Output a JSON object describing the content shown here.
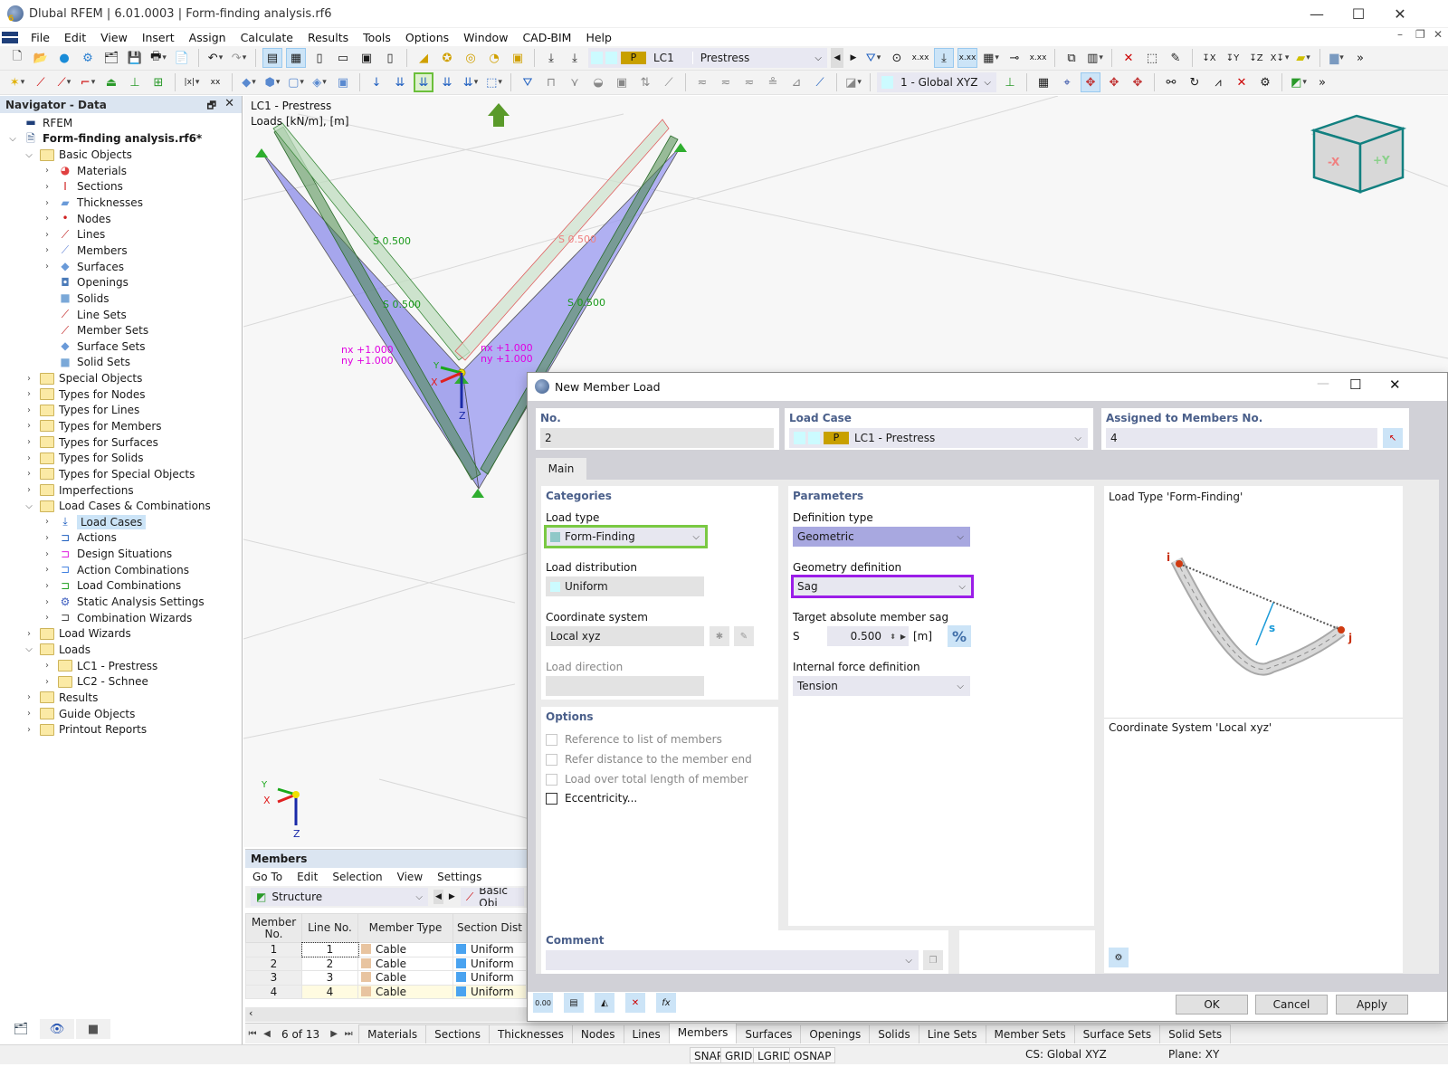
{
  "app": {
    "title": "Dlubal RFEM | 6.01.0003 | Form-finding analysis.rf6",
    "window_controls": {
      "minimize": "—",
      "maximize": "☐",
      "close": "✕"
    }
  },
  "menu": [
    "File",
    "Edit",
    "View",
    "Insert",
    "Assign",
    "Calculate",
    "Results",
    "Tools",
    "Options",
    "Window",
    "CAD-BIM",
    "Help"
  ],
  "toolbar": {
    "load_case": {
      "badge": "P",
      "code": "LC1",
      "name": "Prestress"
    },
    "coordinate_system": "1 - Global XYZ",
    "highlighted_tool": "member-load-button"
  },
  "navigator": {
    "title": "Navigator - Data",
    "items": [
      {
        "label": "RFEM",
        "level": 0,
        "icon": "rfem-icon",
        "chevron": ""
      },
      {
        "label": "Form-finding analysis.rf6*",
        "level": 0,
        "icon": "model-file-icon",
        "chevron": "open",
        "bold": true
      },
      {
        "label": "Basic Objects",
        "level": 1,
        "icon": "folder-icon",
        "chevron": "open"
      },
      {
        "label": "Materials",
        "level": 2,
        "icon": "materials-icon",
        "chevron": "closed"
      },
      {
        "label": "Sections",
        "level": 2,
        "icon": "sections-icon",
        "chevron": "closed"
      },
      {
        "label": "Thicknesses",
        "level": 2,
        "icon": "thicknesses-icon",
        "chevron": "closed"
      },
      {
        "label": "Nodes",
        "level": 2,
        "icon": "nodes-icon",
        "chevron": "closed"
      },
      {
        "label": "Lines",
        "level": 2,
        "icon": "lines-icon",
        "chevron": "closed"
      },
      {
        "label": "Members",
        "level": 2,
        "icon": "members-icon",
        "chevron": "closed"
      },
      {
        "label": "Surfaces",
        "level": 2,
        "icon": "surfaces-icon",
        "chevron": "closed"
      },
      {
        "label": "Openings",
        "level": 2,
        "icon": "openings-icon",
        "chevron": ""
      },
      {
        "label": "Solids",
        "level": 2,
        "icon": "solids-icon",
        "chevron": ""
      },
      {
        "label": "Line Sets",
        "level": 2,
        "icon": "line-sets-icon",
        "chevron": ""
      },
      {
        "label": "Member Sets",
        "level": 2,
        "icon": "member-sets-icon",
        "chevron": ""
      },
      {
        "label": "Surface Sets",
        "level": 2,
        "icon": "surface-sets-icon",
        "chevron": ""
      },
      {
        "label": "Solid Sets",
        "level": 2,
        "icon": "solid-sets-icon",
        "chevron": ""
      },
      {
        "label": "Special Objects",
        "level": 1,
        "icon": "folder-icon",
        "chevron": "closed"
      },
      {
        "label": "Types for Nodes",
        "level": 1,
        "icon": "folder-icon",
        "chevron": "closed"
      },
      {
        "label": "Types for Lines",
        "level": 1,
        "icon": "folder-icon",
        "chevron": "closed"
      },
      {
        "label": "Types for Members",
        "level": 1,
        "icon": "folder-icon",
        "chevron": "closed"
      },
      {
        "label": "Types for Surfaces",
        "level": 1,
        "icon": "folder-icon",
        "chevron": "closed"
      },
      {
        "label": "Types for Solids",
        "level": 1,
        "icon": "folder-icon",
        "chevron": "closed"
      },
      {
        "label": "Types for Special Objects",
        "level": 1,
        "icon": "folder-icon",
        "chevron": "closed"
      },
      {
        "label": "Imperfections",
        "level": 1,
        "icon": "folder-icon",
        "chevron": "closed"
      },
      {
        "label": "Load Cases & Combinations",
        "level": 1,
        "icon": "folder-icon",
        "chevron": "open"
      },
      {
        "label": "Load Cases",
        "level": 2,
        "icon": "load-cases-icon",
        "chevron": "closed",
        "selected": true
      },
      {
        "label": "Actions",
        "level": 2,
        "icon": "actions-icon",
        "chevron": "closed"
      },
      {
        "label": "Design Situations",
        "level": 2,
        "icon": "design-situations-icon",
        "chevron": "closed"
      },
      {
        "label": "Action Combinations",
        "level": 2,
        "icon": "action-combinations-icon",
        "chevron": "closed"
      },
      {
        "label": "Load Combinations",
        "level": 2,
        "icon": "load-combinations-icon",
        "chevron": "closed"
      },
      {
        "label": "Static Analysis Settings",
        "level": 2,
        "icon": "static-analysis-settings-icon",
        "chevron": "closed"
      },
      {
        "label": "Combination Wizards",
        "level": 2,
        "icon": "combination-wizards-icon",
        "chevron": "closed"
      },
      {
        "label": "Load Wizards",
        "level": 1,
        "icon": "folder-icon",
        "chevron": "closed"
      },
      {
        "label": "Loads",
        "level": 1,
        "icon": "folder-icon",
        "chevron": "open"
      },
      {
        "label": "LC1 - Prestress",
        "level": 2,
        "icon": "folder-icon",
        "chevron": "closed"
      },
      {
        "label": "LC2 - Schnee",
        "level": 2,
        "icon": "folder-icon",
        "chevron": "closed"
      },
      {
        "label": "Results",
        "level": 1,
        "icon": "folder-icon",
        "chevron": "closed"
      },
      {
        "label": "Guide Objects",
        "level": 1,
        "icon": "folder-icon",
        "chevron": "closed"
      },
      {
        "label": "Printout Reports",
        "level": 1,
        "icon": "folder-icon",
        "chevron": "closed"
      }
    ]
  },
  "viewport": {
    "label_line1": "LC1 - Prestress",
    "label_line2": "Loads [kN/m], [m]",
    "load_labels": [
      "S 0.500",
      "S 0.500",
      "S 0.500",
      "S 0.500"
    ],
    "surface_labels_left": [
      "nx +1.000",
      "ny +1.000"
    ],
    "surface_labels_right": [
      "nx +1.000",
      "ny +1.000"
    ],
    "axis_labels": {
      "x": "X",
      "y": "Y",
      "z": "Z"
    },
    "view_cube": {
      "left_face": "-X",
      "right_face": "+Y"
    }
  },
  "members_panel": {
    "title": "Members",
    "menu": [
      "Go To",
      "Edit",
      "Selection",
      "View",
      "Settings"
    ],
    "structure_combo": "Structure",
    "basic_objects_combo": "Basic Obj",
    "columns": [
      "Member No.",
      "Line No.",
      "Member Type",
      "Section Dist"
    ],
    "rows": [
      {
        "member": "1",
        "line": "1",
        "type": "Cable",
        "section": "Uniform"
      },
      {
        "member": "2",
        "line": "2",
        "type": "Cable",
        "section": "Uniform"
      },
      {
        "member": "3",
        "line": "3",
        "type": "Cable",
        "section": "Uniform"
      },
      {
        "member": "4",
        "line": "4",
        "type": "Cable",
        "section": "Uniform"
      }
    ],
    "colors": {
      "cable": "#e8c4a0",
      "uniform": "#4aa3f0"
    }
  },
  "sheet_tabs": {
    "page": "6 of 13",
    "tabs": [
      "Materials",
      "Sections",
      "Thicknesses",
      "Nodes",
      "Lines",
      "Members",
      "Surfaces",
      "Openings",
      "Solids",
      "Line Sets",
      "Member Sets",
      "Surface Sets",
      "Solid Sets"
    ],
    "active": "Members"
  },
  "statusbar": {
    "toggles": [
      "SNAP",
      "GRID",
      "LGRID",
      "OSNAP"
    ],
    "cs": "CS: Global XYZ",
    "plane": "Plane: XY"
  },
  "dialog": {
    "title": "New Member Load",
    "no": {
      "label": "No.",
      "value": "2"
    },
    "load_case": {
      "label": "Load Case",
      "badge": "P",
      "value": "LC1 - Prestress"
    },
    "assigned": {
      "label": "Assigned to Members No.",
      "value": "4"
    },
    "tab": "Main",
    "categories": {
      "title": "Categories",
      "load_type_label": "Load type",
      "load_type_value": "Form-Finding",
      "load_distribution_label": "Load distribution",
      "load_distribution_value": "Uniform",
      "coordinate_system_label": "Coordinate system",
      "coordinate_system_value": "Local xyz",
      "load_direction_label": "Load direction",
      "load_direction_value": ""
    },
    "parameters": {
      "title": "Parameters",
      "definition_type_label": "Definition type",
      "definition_type_value": "Geometric",
      "geometry_definition_label": "Geometry definition",
      "geometry_definition_value": "Sag",
      "target_sag_label": "Target absolute member sag",
      "sag_symbol": "S",
      "sag_value": "0.500",
      "sag_unit": "[m]",
      "percent_button": "%",
      "internal_force_label": "Internal force definition",
      "internal_force_value": "Tension"
    },
    "options": {
      "title": "Options",
      "items": [
        {
          "label": "Reference to list of members",
          "checked": false,
          "enabled": false
        },
        {
          "label": "Refer distance to the member end",
          "checked": false,
          "enabled": false
        },
        {
          "label": "Load over total length of member",
          "checked": false,
          "enabled": false
        },
        {
          "label": "Eccentricity...",
          "checked": false,
          "enabled": true
        }
      ]
    },
    "preview": {
      "title": "Load Type 'Form-Finding'",
      "node_i": "i",
      "node_j": "j",
      "sag_label": "s",
      "coord_title": "Coordinate System 'Local xyz'"
    },
    "comment": {
      "label": "Comment",
      "value": ""
    },
    "buttons": {
      "ok": "OK",
      "cancel": "Cancel",
      "apply": "Apply"
    },
    "footer_icons": [
      "units-icon",
      "info-icon",
      "view-icon",
      "delete-icon",
      "formula-icon"
    ]
  }
}
